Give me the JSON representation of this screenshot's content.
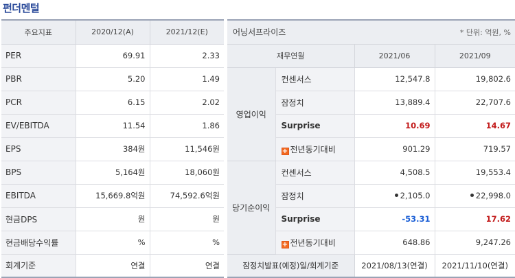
{
  "page_title": "펀더멘털",
  "fundamentals": {
    "headers": [
      "주요지표",
      "2020/12(A)",
      "2021/12(E)"
    ],
    "rows": [
      {
        "label": "PER",
        "v2020": "69.91",
        "v2021": "2.33"
      },
      {
        "label": "PBR",
        "v2020": "5.20",
        "v2021": "1.49"
      },
      {
        "label": "PCR",
        "v2020": "6.15",
        "v2021": "2.02"
      },
      {
        "label": "EV/EBITDA",
        "v2020": "11.54",
        "v2021": "1.86"
      },
      {
        "label": "EPS",
        "v2020": "384원",
        "v2021": "11,546원"
      },
      {
        "label": "BPS",
        "v2020": "5,164원",
        "v2021": "18,060원"
      },
      {
        "label": "EBITDA",
        "v2020": "15,669.8억원",
        "v2021": "74,592.6억원"
      },
      {
        "label": "현금DPS",
        "v2020": "원",
        "v2021": "원"
      },
      {
        "label": "현금배당수익률",
        "v2020": "%",
        "v2021": "%"
      },
      {
        "label": "회계기준",
        "v2020": "연결",
        "v2021": "연결"
      }
    ]
  },
  "earnings": {
    "title": "어닝서프라이즈",
    "unit": "* 단위: 억원, %",
    "sub_headers": [
      "재무연월",
      "2021/06",
      "2021/09"
    ],
    "groups": [
      {
        "name": "영업이익",
        "rows": [
          {
            "label": "컨센서스",
            "v1": "12,547.8",
            "v2": "19,802.6"
          },
          {
            "label": "잠정치",
            "v1": "13,889.4",
            "v2": "22,707.6"
          },
          {
            "label": "Surprise",
            "v1": "10.69",
            "v2": "14.67"
          },
          {
            "label": "전년동기대비",
            "v1": "901.29",
            "v2": "719.57"
          }
        ]
      },
      {
        "name": "당기순이익",
        "rows": [
          {
            "label": "컨센서스",
            "v1": "4,508.5",
            "v2": "19,553.4"
          },
          {
            "label": "잠정치",
            "v1": "2,105.0",
            "v2": "22,998.0"
          },
          {
            "label": "Surprise",
            "v1": "-53.31",
            "v2": "17.62"
          },
          {
            "label": "전년동기대비",
            "v1": "648.86",
            "v2": "9,247.26"
          }
        ]
      }
    ],
    "footer": {
      "label": "잠정치발표(예정)일/회계기준",
      "v1": "2021/08/13(연결)",
      "v2": "2021/11/10(연결)"
    },
    "colors": {
      "positive": "#c21a1a",
      "negative": "#1b5fd6",
      "plus_icon": "#f26a21"
    }
  }
}
